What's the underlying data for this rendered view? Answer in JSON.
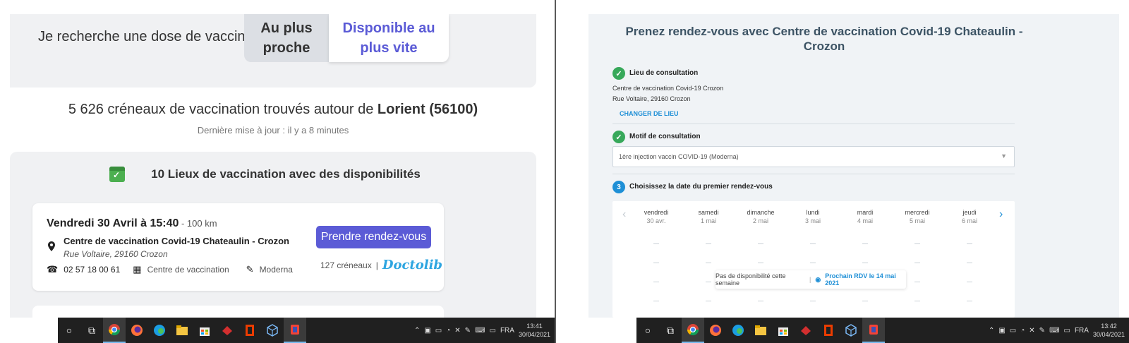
{
  "left": {
    "search_label": "Je recherche une dose de vaccin :",
    "seg_nearest": "Au plus proche",
    "seg_soonest": "Disponible au plus vite",
    "count_prefix": "5 626 créneaux de vaccination trouvés autour de ",
    "count_city": "Lorient (56100)",
    "updated": "Dernière mise à jour : il y a 8 minutes",
    "results_heading": "10 Lieux de vaccination avec des disponibilités",
    "card": {
      "date": "Vendredi 30 Avril à 15:40",
      "distance": " - 100 km",
      "name": "Centre de vaccination Covid-19 Chateaulin - Crozon",
      "address": "Rue Voltaire, 29160 Crozon",
      "phone": "02 57 18 00 61",
      "type": "Centre de vaccination",
      "vaccine": "Moderna",
      "button": "Prendre rendez-vous",
      "slots": "127 créneaux",
      "separator": "|",
      "platform": "Doctolib"
    },
    "taskbar": {
      "lang": "FRA",
      "time": "13:41",
      "date": "30/04/2021"
    }
  },
  "right": {
    "title": "Prenez rendez-vous avec Centre de vaccination Covid-19 Chateaulin - Crozon",
    "lieu_label": "Lieu de consultation",
    "lieu_name": "Centre de vaccination Covid-19 Crozon",
    "lieu_addr": "Rue Voltaire, 29160 Crozon",
    "change_link": "CHANGER DE LIEU",
    "motif_label": "Motif de consultation",
    "motif_value": "1ère injection vaccin COVID-19 (Moderna)",
    "step3_num": "3",
    "step3_label": "Choisissez la date du premier rendez-vous",
    "days": [
      {
        "name": "vendredi",
        "date": "30 avr."
      },
      {
        "name": "samedi",
        "date": "1 mai"
      },
      {
        "name": "dimanche",
        "date": "2 mai"
      },
      {
        "name": "lundi",
        "date": "3 mai"
      },
      {
        "name": "mardi",
        "date": "4 mai"
      },
      {
        "name": "mercredi",
        "date": "5 mai"
      },
      {
        "name": "jeudi",
        "date": "6 mai"
      }
    ],
    "no_avail": "Pas de disponibilité cette semaine",
    "next_rdv": "Prochain RDV le 14 mai 2021",
    "taskbar": {
      "lang": "FRA",
      "time": "13:42",
      "date": "30/04/2021"
    }
  },
  "colors": {
    "primary": "#5b5bd6",
    "doctolib_blue": "#1e8fd6",
    "check_green": "#37a85a"
  },
  "icons": [
    "pin-icon",
    "phone-icon",
    "building-icon",
    "syringe-icon",
    "calendar-check-icon",
    "check-icon",
    "eye-icon",
    "chevron-left-icon",
    "chevron-right-icon"
  ]
}
